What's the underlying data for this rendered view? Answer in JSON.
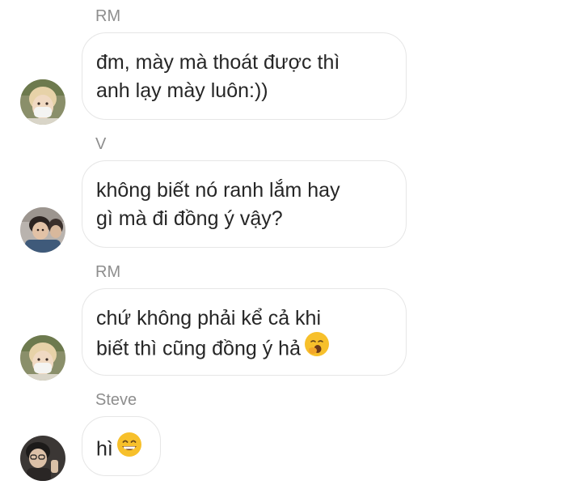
{
  "messages": [
    {
      "sender": "RM",
      "avatar": "rm-avatar-icon",
      "lines": [
        "đm, mày mà thoát được thì",
        "anh lạy mày luôn:))"
      ]
    },
    {
      "sender": "V",
      "avatar": "v-avatar-icon",
      "lines": [
        "không biết nó ranh lắm hay",
        "gì mà đi đồng ý vậy?"
      ]
    },
    {
      "sender": "RM",
      "avatar": "rm-avatar-icon",
      "lines": [
        "chứ không phải kể cả khi",
        "biết thì cũng đồng ý hả"
      ],
      "emoji": "yawning-face-icon"
    },
    {
      "sender": "Steve",
      "avatar": "steve-avatar-icon",
      "lines": [
        "hì"
      ],
      "emoji": "grinning-face-icon"
    }
  ],
  "colors": {
    "sender_name": "#8e8e8e",
    "bubble_border": "#e6e6e6",
    "message_text": "#262626",
    "emoji_yellow": "#f7c02b"
  }
}
